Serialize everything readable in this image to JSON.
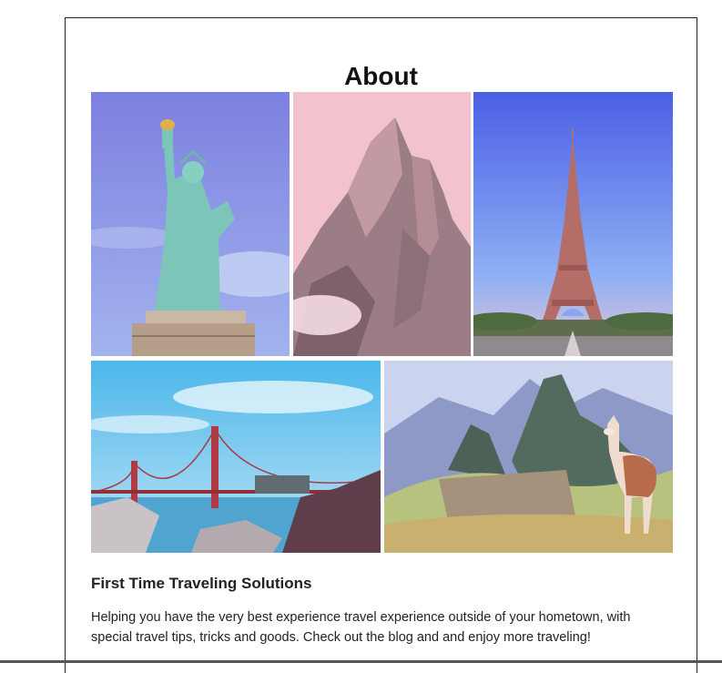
{
  "about": {
    "heading": "About",
    "subtitle": "First Time Traveling Solutions",
    "description": "Helping you have the very best experience travel experience outside of your hometown, with special travel tips, tricks and goods. Check out the blog and and enjoy more traveling!"
  },
  "gallery": [
    {
      "subject": "statue-of-liberty"
    },
    {
      "subject": "mountain-peak"
    },
    {
      "subject": "eiffel-tower"
    },
    {
      "subject": "golden-gate-bridge"
    },
    {
      "subject": "machu-picchu-llama"
    }
  ]
}
